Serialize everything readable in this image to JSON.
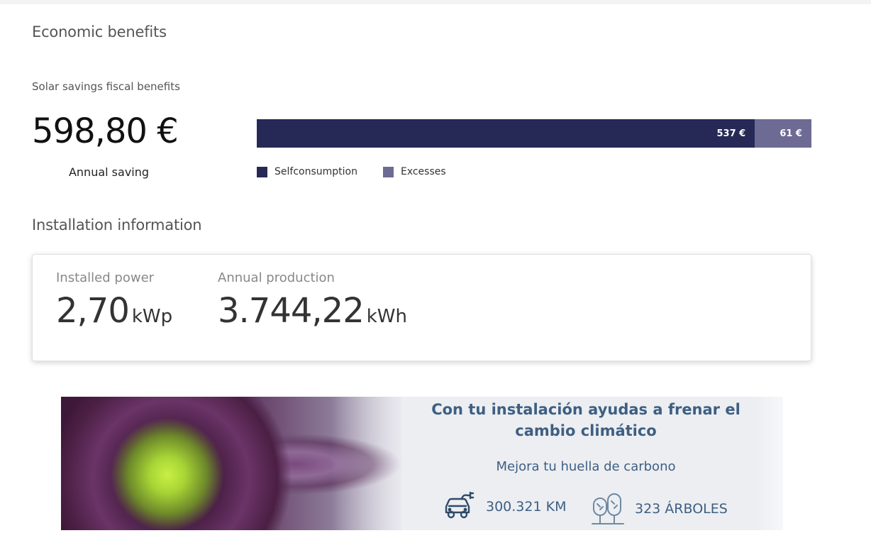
{
  "economic": {
    "title": "Economic benefits",
    "subtitle": "Solar savings fiscal benefits",
    "annual_saving_value": "598,80 €",
    "annual_saving_label": "Annual saving"
  },
  "savings_bar": {
    "segments": [
      {
        "name": "Selfconsumption",
        "label": "537 €",
        "value": 537,
        "color": "#262956"
      },
      {
        "name": "Excesses",
        "label": "61 €",
        "value": 61,
        "color": "#6d6a93"
      }
    ],
    "legend": [
      "Selfconsumption",
      "Excesses"
    ]
  },
  "installation": {
    "title": "Installation information",
    "power_label": "Installed power",
    "power_value": "2,70",
    "power_unit": "kWp",
    "production_label": "Annual production",
    "production_value": "3.744,22",
    "production_unit": "kWh"
  },
  "banner": {
    "heading": "Con tu instalación ayudas a frenar el cambio climático",
    "subheading": "Mejora tu huella de carbono",
    "car_stat": "300.321 KM",
    "tree_stat": "323 ÁRBOLES",
    "car_icon": "electric-car-icon",
    "tree_icon": "trees-icon"
  }
}
